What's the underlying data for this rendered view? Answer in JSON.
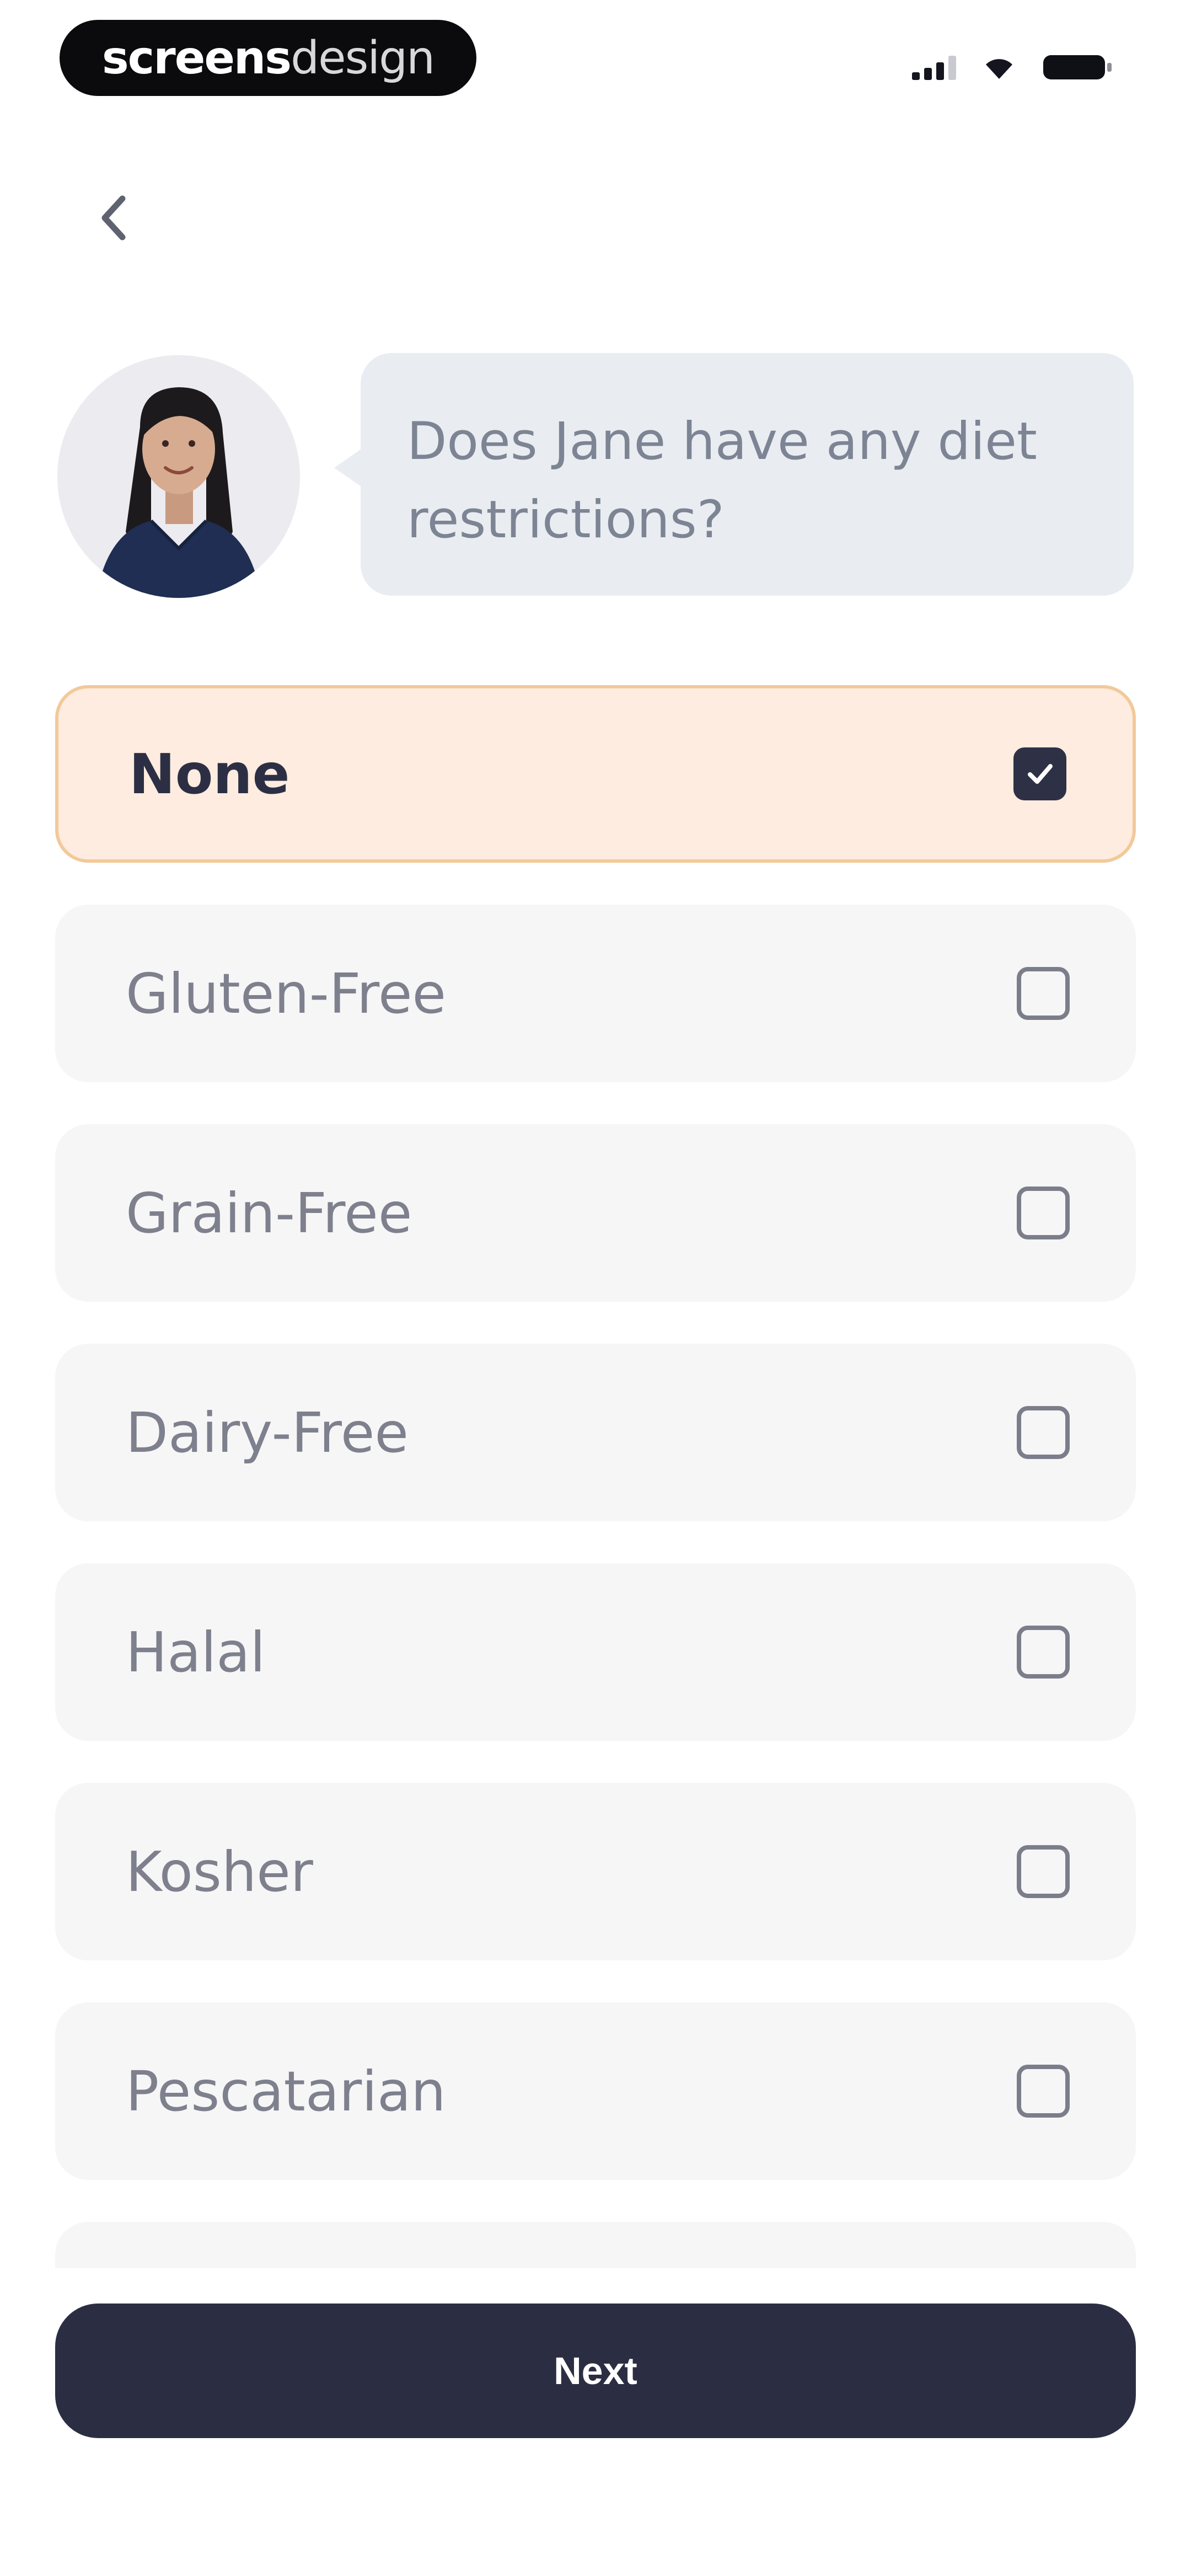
{
  "status_bar": {
    "brand_bold": "screens",
    "brand_light": "design"
  },
  "header": {
    "back_icon": "chevron-left-icon"
  },
  "question": {
    "text": "Does Jane have any diet restrictions?"
  },
  "options": [
    {
      "label": "None",
      "checked": true
    },
    {
      "label": "Gluten-Free",
      "checked": false
    },
    {
      "label": "Grain-Free",
      "checked": false
    },
    {
      "label": "Dairy-Free",
      "checked": false
    },
    {
      "label": "Halal",
      "checked": false
    },
    {
      "label": "Kosher",
      "checked": false
    },
    {
      "label": "Pescatarian",
      "checked": false
    }
  ],
  "footer": {
    "next_label": "Next"
  },
  "colors": {
    "accent_selected_bg": "#fdecdf",
    "accent_selected_border": "#f2c99a",
    "primary": "#2b2e43"
  }
}
